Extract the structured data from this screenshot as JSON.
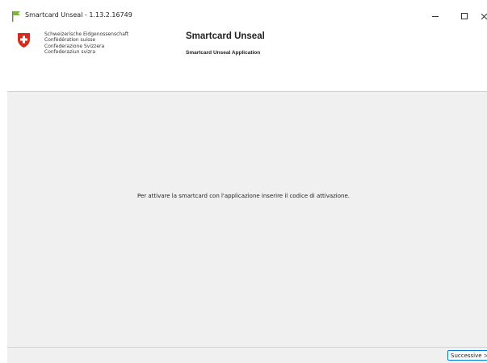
{
  "window": {
    "title": "Smartcard Unseal - 1.13.2.16749",
    "controls": {
      "minimize": "minimize-icon",
      "maximize": "maximize-icon",
      "close": "close-icon"
    }
  },
  "header": {
    "confederation_lines": [
      "Schweizerische Eidgenossenschaft",
      "Confédération suisse",
      "Confederazione Svizzera",
      "Confederaziun svizra"
    ],
    "app_title": "Smartcard Unseal",
    "app_subtitle": "Smartcard Unseal Application"
  },
  "main": {
    "message": "Per attivare la smartcard con l'applicazione inserire il codice di attivazione."
  },
  "footer": {
    "next_label": "Successive >"
  },
  "colors": {
    "shield_red": "#d52b1e",
    "accent": "#0078d7",
    "background": "#f0f0f0"
  }
}
